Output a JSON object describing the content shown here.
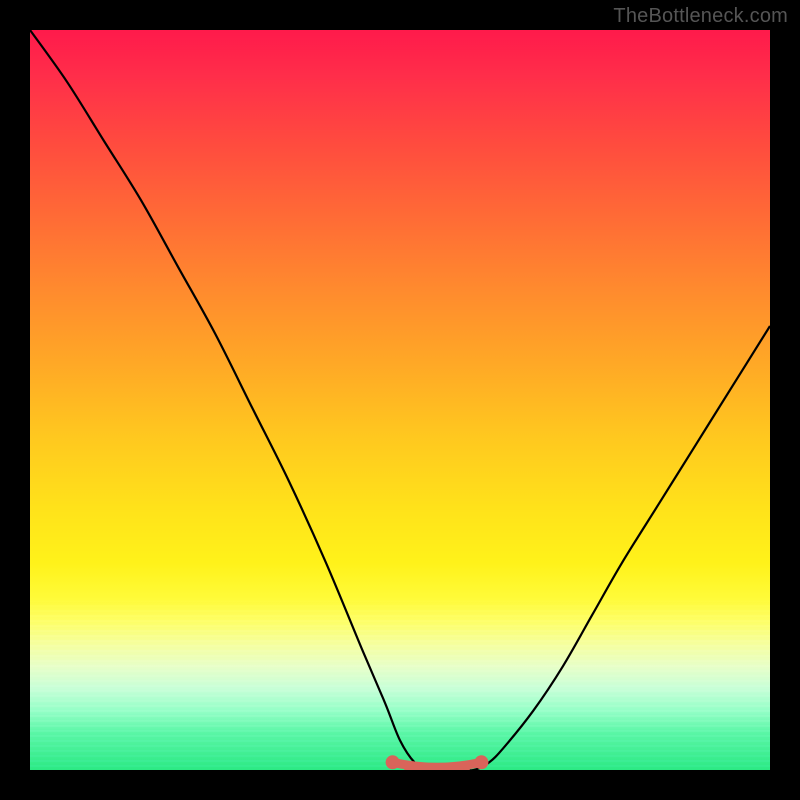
{
  "watermark": "TheBottleneck.com",
  "chart_data": {
    "type": "line",
    "title": "",
    "xlabel": "",
    "ylabel": "",
    "xlim": [
      0,
      100
    ],
    "ylim": [
      0,
      100
    ],
    "grid": false,
    "legend_position": "none",
    "annotations": [],
    "series": [
      {
        "name": "bottleneck-curve",
        "x": [
          0,
          5,
          10,
          15,
          20,
          25,
          30,
          35,
          40,
          45,
          48,
          50,
          52,
          54,
          56,
          58,
          60,
          62,
          64,
          68,
          72,
          76,
          80,
          85,
          90,
          95,
          100
        ],
        "values": [
          100,
          93,
          85,
          77,
          68,
          59,
          49,
          39,
          28,
          16,
          9,
          4,
          1,
          0,
          0,
          0,
          0,
          1,
          3,
          8,
          14,
          21,
          28,
          36,
          44,
          52,
          60
        ]
      }
    ],
    "marker_region": {
      "x_start": 49,
      "x_end": 61,
      "y": 0.5
    },
    "gradient_stops": [
      {
        "pos": 0,
        "color": "#ff1a4b"
      },
      {
        "pos": 50,
        "color": "#ffc81f"
      },
      {
        "pos": 80,
        "color": "#feff6a"
      },
      {
        "pos": 100,
        "color": "#2dea86"
      }
    ],
    "line_color": "#000000",
    "marker_color": "#d9645a"
  }
}
